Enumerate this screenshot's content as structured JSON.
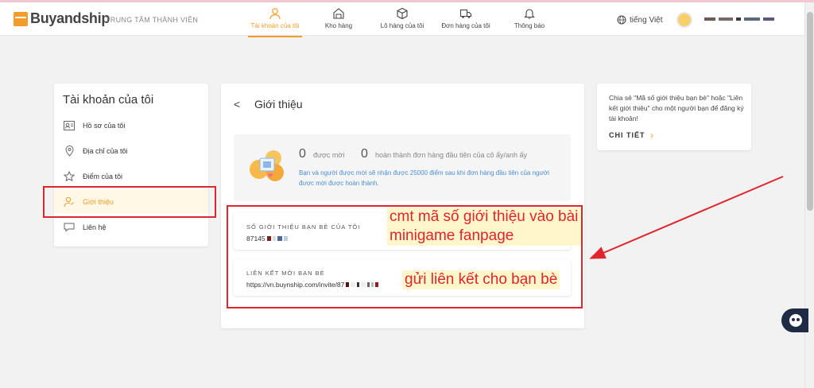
{
  "brand": {
    "name": "Buyandship",
    "subtitle": "TRUNG TÂM THÀNH VIÊN"
  },
  "nav": [
    {
      "label": "Tài khoản của tôi",
      "icon": "user-icon",
      "active": true
    },
    {
      "label": "Kho hàng",
      "icon": "warehouse-icon",
      "active": false
    },
    {
      "label": "Lô hàng của tôi",
      "icon": "box-icon",
      "active": false
    },
    {
      "label": "Đơn hàng của tôi",
      "icon": "truck-icon",
      "active": false
    },
    {
      "label": "Thông báo",
      "icon": "bell-icon",
      "active": false
    }
  ],
  "language": "tiếng Việt",
  "sidebar": {
    "title": "Tài khoản của tôi",
    "items": [
      {
        "label": "Hồ sơ của tôi",
        "icon": "profile-card-icon"
      },
      {
        "label": "Địa chỉ của tôi",
        "icon": "location-pin-icon"
      },
      {
        "label": "Điểm của tôi",
        "icon": "star-icon"
      },
      {
        "label": "Giới thiệu",
        "icon": "user-referral-icon",
        "active": true
      },
      {
        "label": "Liên hệ",
        "icon": "chat-icon"
      }
    ]
  },
  "main": {
    "back": "<",
    "title": "Giới thiệu",
    "invited_count": "0",
    "invited_label": "được mời",
    "completed_count": "0",
    "completed_label": "hoàn thành đơn hàng đầu tiên của cô ấy/anh ấy",
    "description": "Bạn và người được mời sẽ nhận được 25000 điểm sau khi đơn hàng đầu tiên của người được mời được hoàn thành.",
    "referral_code_label": "SỐ GIỚI THIỆU BẠN BÈ CỦA TÔI",
    "referral_code_value": "87145",
    "referral_link_label": "LIÊN KẾT MỜI BẠN BÈ",
    "referral_link_value": "https://vn.buynship.com/invite/87"
  },
  "annotations": {
    "code_note": "cmt mã số giới thiệu vào bài minigame fanpage",
    "link_note": "gửi liên kết cho bạn bè"
  },
  "right_panel": {
    "text": "Chia sẻ \"Mã số giới thiệu bạn bè\" hoặc \"Liên kết giới thiệu\" cho một người bạn để đăng ký tài khoản!",
    "link": "CHI TIẾT"
  },
  "colors": {
    "accent": "#f39b2b",
    "annotation_red": "#e0252c",
    "link_blue": "#4a8ed6"
  }
}
